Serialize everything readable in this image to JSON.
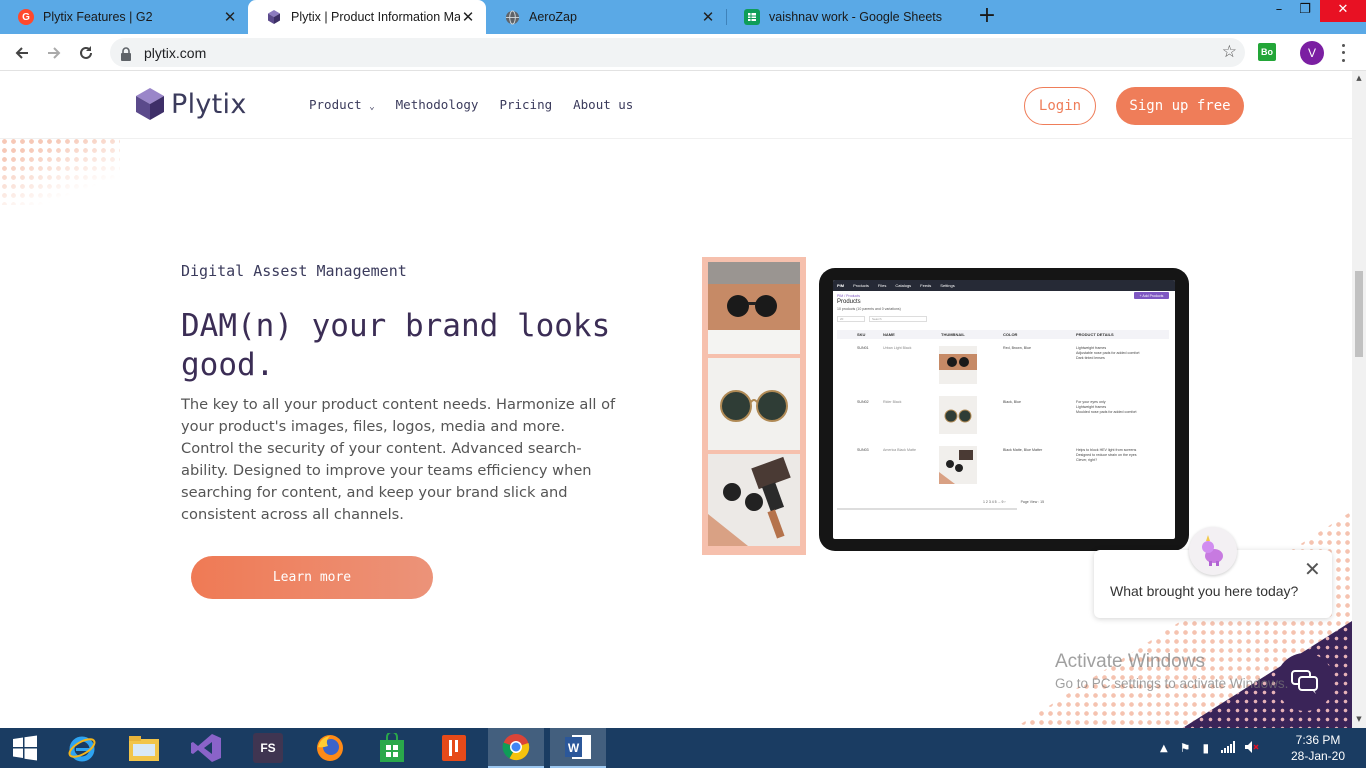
{
  "browser": {
    "tabs": [
      {
        "title": "Plytix Features | G2",
        "favicon": "g2-logo",
        "color": "#ff492c"
      },
      {
        "title": "Plytix | Product Information Mana",
        "favicon": "plytix-cube",
        "color": "#5b4a8b"
      },
      {
        "title": "AeroZap",
        "favicon": "globe-icon",
        "color": "#5f6368"
      },
      {
        "title": "vaishnav work - Google Sheets",
        "favicon": "sheets-icon",
        "color": "#0f9d58"
      }
    ],
    "url": "plytix.com",
    "extension_label": "Bo",
    "profile_initial": "V"
  },
  "site": {
    "logo_text": "Plytix",
    "nav": [
      "Product",
      "Methodology",
      "Pricing",
      "About us"
    ],
    "login_label": "Login",
    "signup_label": "Sign up free"
  },
  "hero": {
    "eyebrow": "Digital Assest Management",
    "headline": "DAM(n) your brand looks good.",
    "body": "The key to all your product content needs. Harmonize all of your product's images, files, logos, media and more. Control the security of your content. Advanced search-ability. Designed to improve your teams efficiency when searching for content, and keep your brand slick and consistent across all channels.",
    "cta_label": "Learn more"
  },
  "tablet_screen": {
    "menu": [
      "PIM",
      "Products",
      "Files",
      "Catalogs",
      "Feeds",
      "Settings"
    ],
    "breadcrumb": "PIM / Products",
    "title": "Products",
    "subtitle": "10 products (10 parents and 0 variations)",
    "add_button": "+ Add Products",
    "filter_label": "20",
    "search_placeholder": "Search",
    "columns": [
      "SKU",
      "NAME",
      "THUMBNAIL",
      "COLOR",
      "PRODUCT DETAILS"
    ],
    "rows": [
      {
        "sku": "SUN01",
        "name": "Urban Light Black",
        "color": "Red, Brown, Blue",
        "details": [
          "Lightweight frames",
          "Adjustable nose pads for added comfort",
          "Dark tinted lenses"
        ]
      },
      {
        "sku": "SUN02",
        "name": "Rider Black",
        "color": "Black, Blue",
        "details": [
          "For your eyes only",
          "Lightweight frames",
          "Moulded nose pads for added comfort"
        ]
      },
      {
        "sku": "SUN03",
        "name": "America Black Matte",
        "color": "Black Matte, Blue Matter",
        "details": [
          "Helps to block HEV light from screens",
          "Designed to reduce strain on the eyes",
          "Clever, right?"
        ]
      }
    ],
    "pagination": "1  2  3  4  5  ...  9  ›",
    "page_view": "Page View : 15"
  },
  "chat": {
    "question": "What brought you here today?"
  },
  "watermark": {
    "line1": "Activate Windows",
    "line2": "Go to PC settings to activate Windows."
  },
  "taskbar": {
    "time": "7:36 PM",
    "date": "28-Jan-20"
  }
}
